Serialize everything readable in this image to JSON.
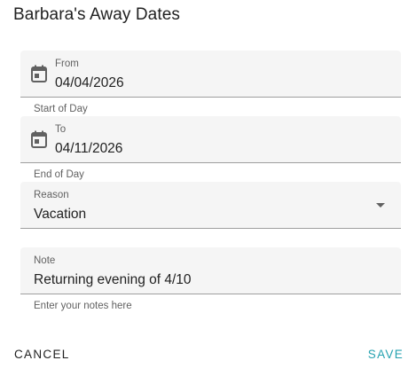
{
  "dialog": {
    "title": "Barbara's Away Dates"
  },
  "from_field": {
    "label": "From",
    "value": "04/04/2026",
    "helper": "Start of Day",
    "icon": "calendar-icon"
  },
  "to_field": {
    "label": "To",
    "value": "04/11/2026",
    "helper": "End of Day",
    "icon": "calendar-icon"
  },
  "reason_field": {
    "label": "Reason",
    "value": "Vacation",
    "icon": "chevron-down-icon"
  },
  "note_field": {
    "label": "Note",
    "value": "Returning evening of 4/10",
    "helper": "Enter your notes here"
  },
  "actions": {
    "cancel_label": "CANCEL",
    "save_label": "SAVE"
  },
  "colors": {
    "accent": "#26a2b0",
    "field_bg": "#f5f5f5",
    "underline": "#9e9e9e"
  }
}
